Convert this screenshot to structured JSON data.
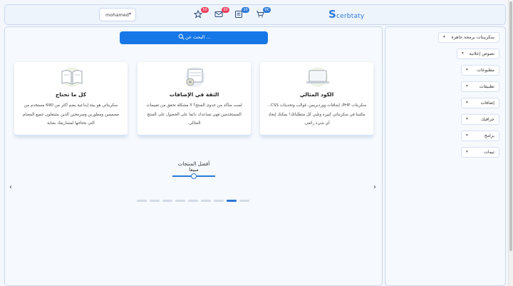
{
  "header": {
    "brand_initial": "S",
    "brand_rest": "cerbtaty",
    "icons": [
      {
        "name": "cart-icon",
        "badge": "0€",
        "badge_color": "blue"
      },
      {
        "name": "orders-icon",
        "badge": "10",
        "badge_color": "blue"
      },
      {
        "name": "messages-icon",
        "badge": "50",
        "badge_color": "red"
      },
      {
        "name": "favorites-icon",
        "badge": "50",
        "badge_color": "red"
      }
    ],
    "user": "mohamed"
  },
  "search": {
    "label": "البحث عن ..."
  },
  "cards": [
    {
      "title": "الكود المثالي",
      "desc": "سكربتات PHP، إضافات ووردبريس، قوالب وتحديثات CSS... مكتبنا في سكربتاتي كبيرة وتلبي كل متطلباتك! يمكنك إيجاد أي شيء رائعي."
    },
    {
      "title": "الثقة في الإضافات",
      "desc": "لست متأكد من جدوى المنتج؟ لا مشكلة تحقق من تقييمات المستخدمين فهي تساعدك دائما على الحصول على المنتج المثالي."
    },
    {
      "title": "كل ما تحتاج",
      "desc": "سكربتاتي هو بيئة إبداعية يضم أكثر من 690 مستخدم من مصممين ومطورين ومبرمجين الذين يشتغلون جميع المصام التي تحتاجها لمشاريعك بعناية"
    }
  ],
  "best_sellers": {
    "title": "أفضل المنتجات مبيعا"
  },
  "carousel": {
    "count": 9,
    "active_index": 7,
    "prev": "‹",
    "next": "›"
  },
  "sidebar": {
    "items": [
      "سكريبتات برمجة جاهزة",
      "نصوص إعلانية",
      "مطبوعات",
      "تطبيقات",
      "إضافات",
      "جرافيك",
      "برامج",
      "ثيمات"
    ]
  },
  "colors": {
    "accent": "#1777e6",
    "badge_red": "#e83e5c"
  }
}
